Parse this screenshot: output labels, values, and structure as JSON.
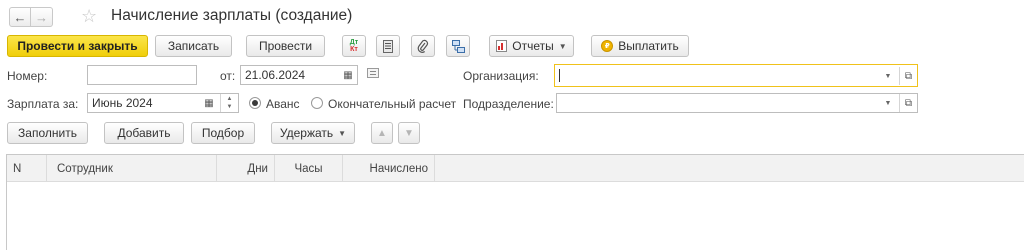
{
  "window": {
    "title": "Начисление зарплаты (создание)"
  },
  "toolbar": {
    "post_and_close": "Провести и закрыть",
    "save": "Записать",
    "post": "Провести",
    "dt_kt_top": "Дт",
    "dt_kt_bottom": "Кт",
    "reports": "Отчеты",
    "pay": "Выплатить"
  },
  "form": {
    "number_label": "Номер:",
    "number_value": "",
    "date_label": "от:",
    "date_value": "21.06.2024",
    "organization_label": "Организация:",
    "organization_value": "",
    "salary_for_label": "Зарплата за:",
    "salary_for_value": "Июнь 2024",
    "radio_advance": "Аванс",
    "radio_final": "Окончательный расчет",
    "radio_selected": "Аванс",
    "department_label": "Подразделение:",
    "department_value": ""
  },
  "actions": {
    "fill": "Заполнить",
    "add": "Добавить",
    "select": "Подбор",
    "withhold": "Удержать"
  },
  "table": {
    "columns": [
      "N",
      "Сотрудник",
      "Дни",
      "Часы",
      "Начислено"
    ],
    "rows": []
  },
  "colors": {
    "primary_button": "#f5d51b",
    "focus_border": "#f0c21a",
    "dt_kt_green": "#2f9e44",
    "dt_kt_red": "#d92b2b",
    "reports_red": "#d62f2f",
    "pay_coin": "#f0b400"
  }
}
